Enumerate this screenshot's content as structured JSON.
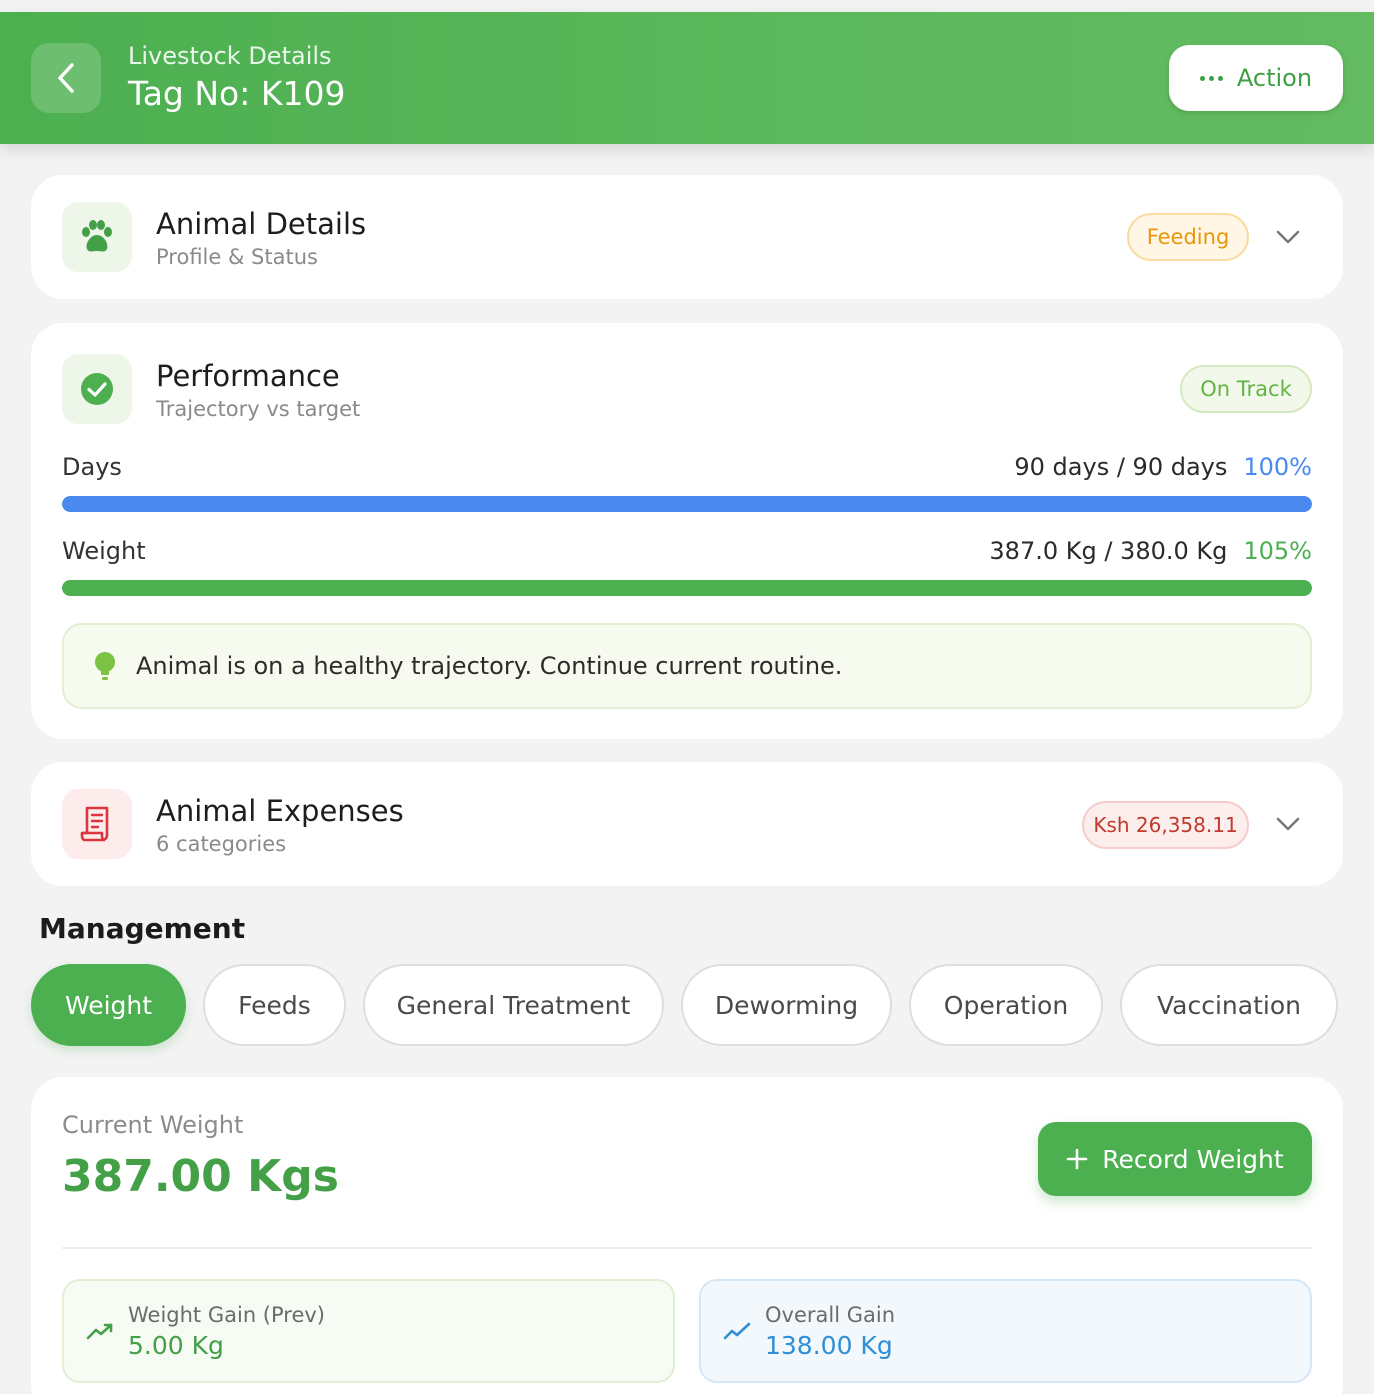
{
  "header": {
    "subtitle": "Livestock Details",
    "title": "Tag No: K109",
    "action_label": "Action"
  },
  "animal_details": {
    "title": "Animal Details",
    "subtitle": "Profile & Status",
    "badge": "Feeding"
  },
  "performance": {
    "title": "Performance",
    "subtitle": "Trajectory vs target",
    "badge": "On Track",
    "days": {
      "label": "Days",
      "value": "90 days / 90 days",
      "percent": "100%",
      "fill_fraction": 1.0,
      "color": "#4a89f0"
    },
    "weight": {
      "label": "Weight",
      "value": "387.0 Kg / 380.0 Kg",
      "percent": "105%",
      "fill_fraction": 1.0,
      "color": "#4caf50"
    },
    "tip": "Animal is on a healthy trajectory. Continue current routine."
  },
  "expenses": {
    "title": "Animal Expenses",
    "subtitle": "6 categories",
    "badge": "Ksh 26,358.11"
  },
  "management": {
    "title": "Management",
    "tabs": [
      "Weight",
      "Feeds",
      "General Treatment",
      "Deworming",
      "Operation",
      "Vaccination"
    ],
    "active_tab": "Weight"
  },
  "weight_panel": {
    "current_label": "Current Weight",
    "current_value": "387.00 Kgs",
    "record_label": "Record Weight",
    "gain_prev_label": "Weight Gain (Prev)",
    "gain_prev_value": "5.00 Kg",
    "overall_label": "Overall Gain",
    "overall_value": "138.00 Kg"
  },
  "colors": {
    "brand_green": "#4caf50",
    "feeding_badge": "#f0a020",
    "on_track_badge": "#6cbf4a",
    "expense_badge": "#c0392b",
    "days_bar": "#4a89f0",
    "overall_gain": "#2f8fd6"
  }
}
